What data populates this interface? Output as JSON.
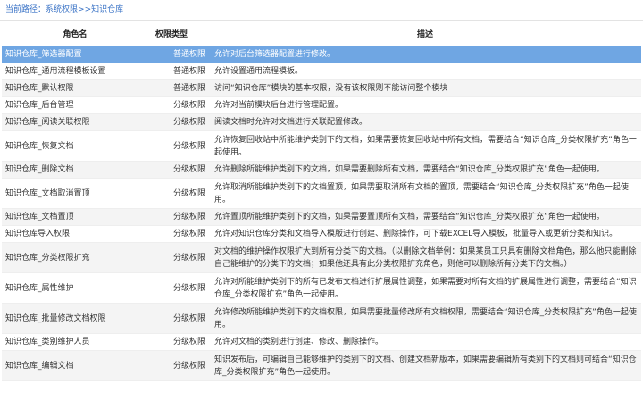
{
  "breadcrumb": {
    "prefix": "当前路径：",
    "path1": "系统权限",
    "sep": ">>",
    "path2": "知识仓库"
  },
  "table": {
    "headers": [
      "角色名",
      "权限类型",
      "描述"
    ],
    "rows": [
      {
        "name": "知识仓库_筛选器配置",
        "type": "普通权限",
        "desc": "允许对后台筛选器配置进行修改。"
      },
      {
        "name": "知识仓库_通用流程模板设置",
        "type": "普通权限",
        "desc": "允许设置通用流程模板。"
      },
      {
        "name": "知识仓库_默认权限",
        "type": "普通权限",
        "desc": "访问“知识仓库”模块的基本权限，没有该权限则不能访问整个模块"
      },
      {
        "name": "知识仓库_后台管理",
        "type": "分级权限",
        "desc": "允许对当前模块后台进行管理配置。"
      },
      {
        "name": "知识仓库_阅读关联权限",
        "type": "分级权限",
        "desc": "阅读文档时允许对文档进行关联配置修改。"
      },
      {
        "name": "知识仓库_恢复文档",
        "type": "分级权限",
        "desc": "允许恢复回收站中所能维护类别下的文档，如果需要恢复回收站中所有文档，需要结合“知识仓库_分类权限扩充”角色一起使用。"
      },
      {
        "name": "知识仓库_删除文档",
        "type": "分级权限",
        "desc": "允许删除所能维护类别下的文档，如果需要删除所有文档，需要结合“知识仓库_分类权限扩充”角色一起使用。"
      },
      {
        "name": "知识仓库_文档取消置顶",
        "type": "分级权限",
        "desc": "允许取消所能维护类别下的文档置顶，如果需要取消所有文档的置顶，需要结合“知识仓库_分类权限扩充”角色一起使用。"
      },
      {
        "name": "知识仓库_文档置顶",
        "type": "分级权限",
        "desc": "允许置顶所能维护类别下的文档，如果需要置顶所有文档，需要结合“知识仓库_分类权限扩充”角色一起使用。"
      },
      {
        "name": "知识仓库导入权限",
        "type": "分级权限",
        "desc": "允许对知识仓库分类和文档导入模版进行创建、删除操作，可下载EXCEL导入模板，批量导入或更新分类和知识。"
      },
      {
        "name": "知识仓库_分类权限扩充",
        "type": "分级权限",
        "desc": "对文档的维护操作权限扩大到所有分类下的文档。（以删除文档举例：如果某员工只具有删除文档角色，那么他只能删除自己能维护的分类下的文档；如果他还具有此分类权限扩充角色，则他可以删除所有分类下的文档。）"
      },
      {
        "name": "知识仓库_属性维护",
        "type": "分级权限",
        "desc": "允许对所能维护类别下的所有已发布文档进行扩展属性调整，如果需要对所有文档的扩展属性进行调整，需要结合“知识仓库_分类权限扩充”角色一起使用。"
      },
      {
        "name": "知识仓库_批量修改文档权限",
        "type": "分级权限",
        "desc": "允许修改所能维护类别下的文档权限，如果需要批量修改所有文档权限，需要结合“知识仓库_分类权限扩充”角色一起使用。"
      },
      {
        "name": "知识仓库_类别维护人员",
        "type": "分级权限",
        "desc": "允许对文档的类别进行创建、修改、删除操作。"
      },
      {
        "name": "知识仓库_编辑文档",
        "type": "分级权限",
        "desc": "知识发布后，可编辑自己能够维护的类别下的文档、创建文档新版本，如果需要编辑所有类别下的文档则可结合“知识仓库_分类权限扩充”角色一起使用。"
      }
    ]
  },
  "colors": {
    "selected_row": "#6fa6e3",
    "link": "#3a73c6"
  }
}
